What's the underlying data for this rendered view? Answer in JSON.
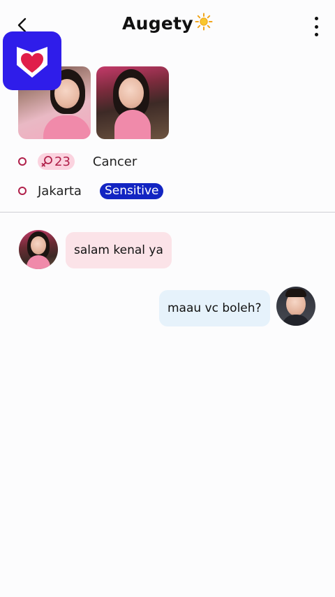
{
  "header": {
    "title": "Augety",
    "back_icon": "chevron-left-icon",
    "more_icon": "more-vertical-icon"
  },
  "logo": {
    "icon": "heart-shield-icon",
    "color": "#2f1dea"
  },
  "profile": {
    "age": "23",
    "zodiac": "Cancer",
    "city": "Jakarta",
    "badge": "Sensitive"
  },
  "colors": {
    "accent": "#b0204a",
    "age_pill_bg": "#fbd3df",
    "badge_bg": "#1325c2",
    "incoming_bubble": "#fbe3e8",
    "outgoing_bubble": "#e6f2fb"
  },
  "messages": [
    {
      "from": "them",
      "text": "salam kenal ya"
    },
    {
      "from": "me",
      "text": "maau vc boleh?"
    }
  ]
}
